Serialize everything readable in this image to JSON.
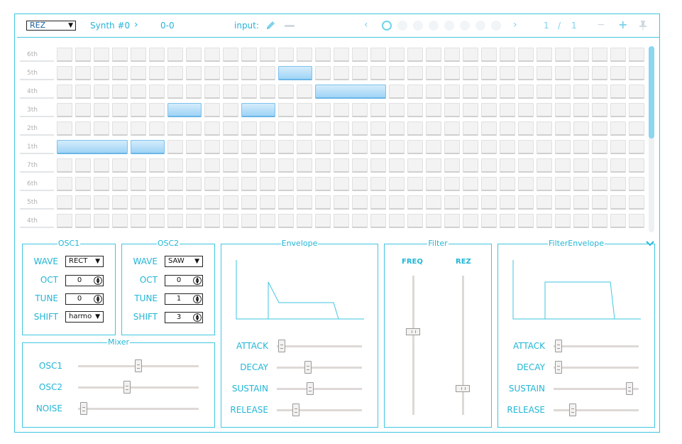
{
  "header": {
    "preset_select": "REZ",
    "synth_name": "Synth #0",
    "synth_arrow": "›",
    "position": "0-0",
    "input_label": "input:",
    "prev_arrow": "‹",
    "next_arrow": "›",
    "page_current": "1",
    "page_sep": "/",
    "page_total": "1",
    "minus_label": "−",
    "plus_label": "+",
    "pin_icon": "pin-icon",
    "pattern_dots": 8,
    "active_dot": 0
  },
  "grid": {
    "rows": [
      "6th",
      "5th",
      "4th",
      "3th",
      "2th",
      "1th",
      "7th",
      "6th",
      "5th",
      "4th"
    ],
    "columns": 32,
    "notes": [
      {
        "row": 1,
        "start": 12,
        "length": 2
      },
      {
        "row": 2,
        "start": 14,
        "length": 4
      },
      {
        "row": 3,
        "start": 6,
        "length": 2
      },
      {
        "row": 3,
        "start": 10,
        "length": 2
      },
      {
        "row": 5,
        "start": 0,
        "length": 4
      },
      {
        "row": 5,
        "start": 4,
        "length": 2
      }
    ]
  },
  "osc1": {
    "title": "OSC1",
    "wave_label": "WAVE",
    "wave_value": "RECT",
    "oct_label": "OCT",
    "oct_value": "0",
    "tune_label": "TUNE",
    "tune_value": "0",
    "shift_label": "SHIFT",
    "shift_value": "harmo"
  },
  "osc2": {
    "title": "OSC2",
    "wave_label": "WAVE",
    "wave_value": "SAW",
    "oct_label": "OCT",
    "oct_value": "0",
    "tune_label": "TUNE",
    "tune_value": "1",
    "shift_label": "SHIFT",
    "shift_value": "3"
  },
  "mixer": {
    "title": "Mixer",
    "sliders": [
      {
        "label": "OSC1",
        "value": 0.5
      },
      {
        "label": "OSC2",
        "value": 0.4
      },
      {
        "label": "NOISE",
        "value": 0.02
      }
    ]
  },
  "envelope": {
    "title": "Envelope",
    "sliders": [
      {
        "label": "ATTACK",
        "value": 0.02
      },
      {
        "label": "DECAY",
        "value": 0.35
      },
      {
        "label": "SUSTAIN",
        "value": 0.38
      },
      {
        "label": "RELEASE",
        "value": 0.2
      }
    ]
  },
  "filter": {
    "title": "Filter",
    "freq_label": "FREQ",
    "freq_value": 0.6,
    "rez_label": "REZ",
    "rez_value": 0.17
  },
  "filter_envelope": {
    "title": "FilterEnvelope",
    "sliders": [
      {
        "label": "ATTACK",
        "value": 0.02
      },
      {
        "label": "DECAY",
        "value": 0.02
      },
      {
        "label": "SUSTAIN",
        "value": 0.93
      },
      {
        "label": "RELEASE",
        "value": 0.2
      }
    ]
  },
  "colors": {
    "accent": "#22b6d6",
    "note": "#9fd4f6",
    "border": "#3fc6e0"
  }
}
